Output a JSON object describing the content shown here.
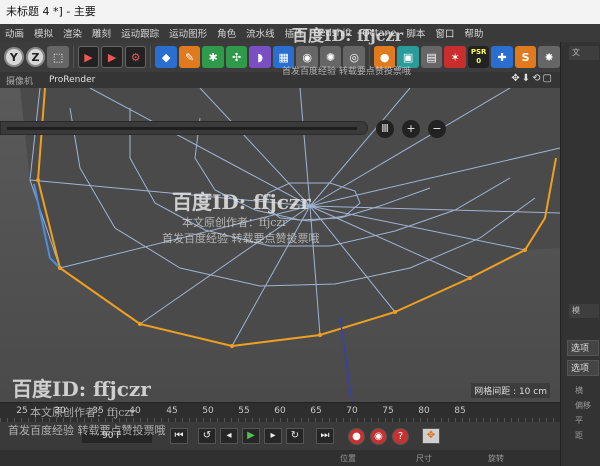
{
  "window": {
    "title": "未标题 4 *] - 主要"
  },
  "menu": [
    "动画",
    "模拟",
    "渲染",
    "雕刻",
    "运动跟踪",
    "运动图形",
    "角色",
    "流水线",
    "插件",
    "Redshift",
    "Octane",
    "脚本",
    "窗口",
    "帮助"
  ],
  "toolbar": {
    "axis_buttons": [
      "Y",
      "Z"
    ],
    "psr_label": "PSR",
    "psr_value": "0"
  },
  "viewport": {
    "header_left": "摄像机",
    "header_tab": "ProRender",
    "header_controls": "✥⬇⟲▢",
    "hud_buttons": [
      "Ⅲ",
      "+",
      "−"
    ],
    "grid_spacing": "网格间距 : 10 cm"
  },
  "timeline": {
    "ticks": [
      "25",
      "30",
      "35",
      "40",
      "45",
      "50",
      "55",
      "60",
      "65",
      "70",
      "75",
      "80",
      "85"
    ]
  },
  "playback": {
    "current_frame": "90 F"
  },
  "right_panel": {
    "tab_top": "文",
    "tab_mid": "模",
    "btn_select": "选项",
    "btn_select2": "选项",
    "labels": [
      "横",
      "偏移",
      "平",
      "距"
    ]
  },
  "bottom": {
    "labels": [
      "位置",
      "尺寸",
      "旋转"
    ]
  },
  "watermarks": {
    "id": "百度ID: ffjczr",
    "line1": "本文原创作者：ffjczr",
    "line2": "首发百度经验  转载要点赞投票哦"
  },
  "colors": {
    "mesh_lines": "#9fb4d4",
    "mesh_selected_edge": "#f0a020",
    "viewport_bg": "#555555"
  }
}
